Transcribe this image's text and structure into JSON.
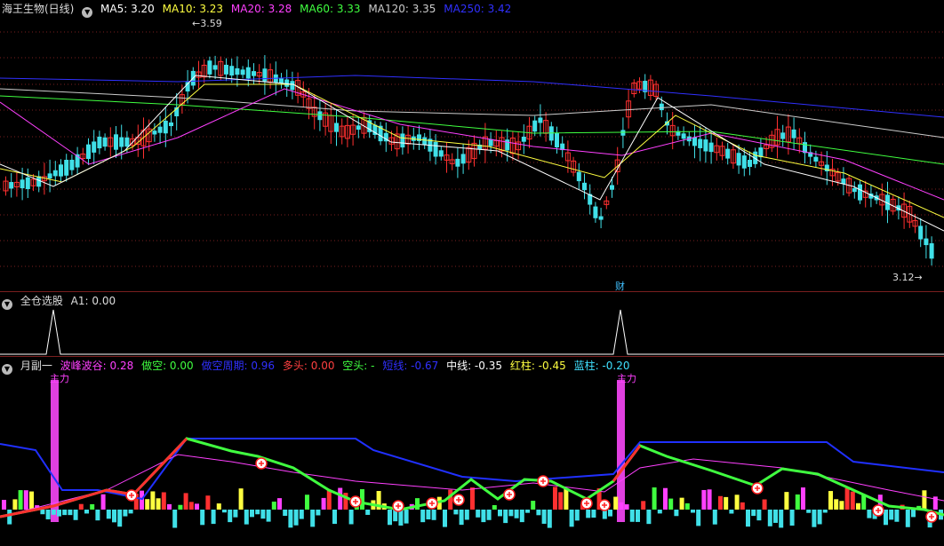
{
  "main": {
    "title": "海王生物(日线)",
    "ma": [
      {
        "label": "MA5: 3.20",
        "color": "#ffffff"
      },
      {
        "label": "MA10: 3.23",
        "color": "#ffff40"
      },
      {
        "label": "MA20: 3.28",
        "color": "#ff40ff"
      },
      {
        "label": "MA60: 3.33",
        "color": "#40ff40"
      },
      {
        "label": "MA120: 3.35",
        "color": "#cccccc"
      },
      {
        "label": "MA250: 3.42",
        "color": "#3030ff"
      }
    ],
    "high_label": "3.59",
    "low_label": "3.12",
    "event_label": "财"
  },
  "selector": {
    "title": "全仓选股",
    "value": "A1: 0.00"
  },
  "sub": {
    "title": "月副一",
    "items": [
      {
        "label": "波峰波谷: 0.28",
        "color": "#ff40ff"
      },
      {
        "label": "做空: 0.00",
        "color": "#40ff40"
      },
      {
        "label": "做空周期: 0.96",
        "color": "#3030ff"
      },
      {
        "label": "多头: 0.00",
        "color": "#ff4040"
      },
      {
        "label": "空头: -",
        "color": "#40ff40"
      },
      {
        "label": "短线: -0.67",
        "color": "#3030ff"
      },
      {
        "label": "中线: -0.35",
        "color": "#ffffff"
      },
      {
        "label": "红柱: -0.45",
        "color": "#ffff40"
      },
      {
        "label": "蓝柱: -0.20",
        "color": "#40e0ff"
      }
    ],
    "spike_label": "主力"
  },
  "colors": {
    "up": "#ff3030",
    "down": "#40e0e8",
    "grid": "#7a1f1f"
  }
}
